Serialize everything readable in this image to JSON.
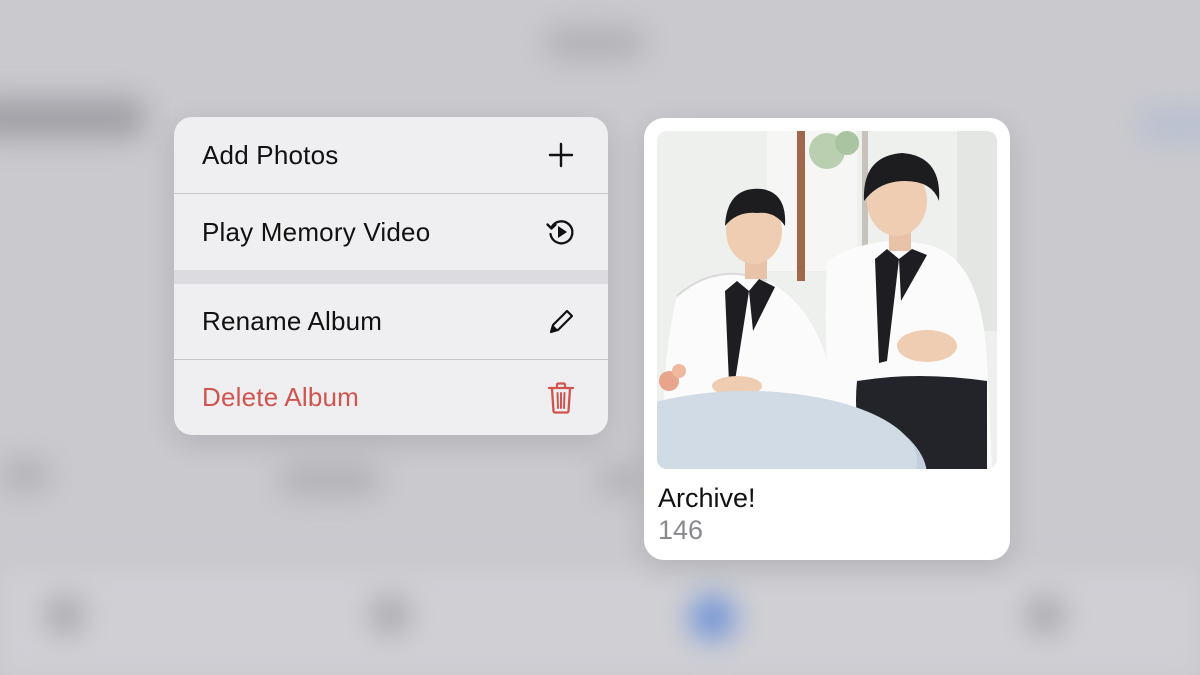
{
  "menu": {
    "items": [
      {
        "label": "Add Photos",
        "icon": "plus-icon"
      },
      {
        "label": "Play Memory Video",
        "icon": "memory-play-icon"
      },
      {
        "label": "Rename Album",
        "icon": "pencil-icon"
      },
      {
        "label": "Delete Album",
        "icon": "trash-icon",
        "destructive": true
      }
    ],
    "destructive_color": "#d0554e"
  },
  "album": {
    "title": "Archive!",
    "count": "146"
  }
}
